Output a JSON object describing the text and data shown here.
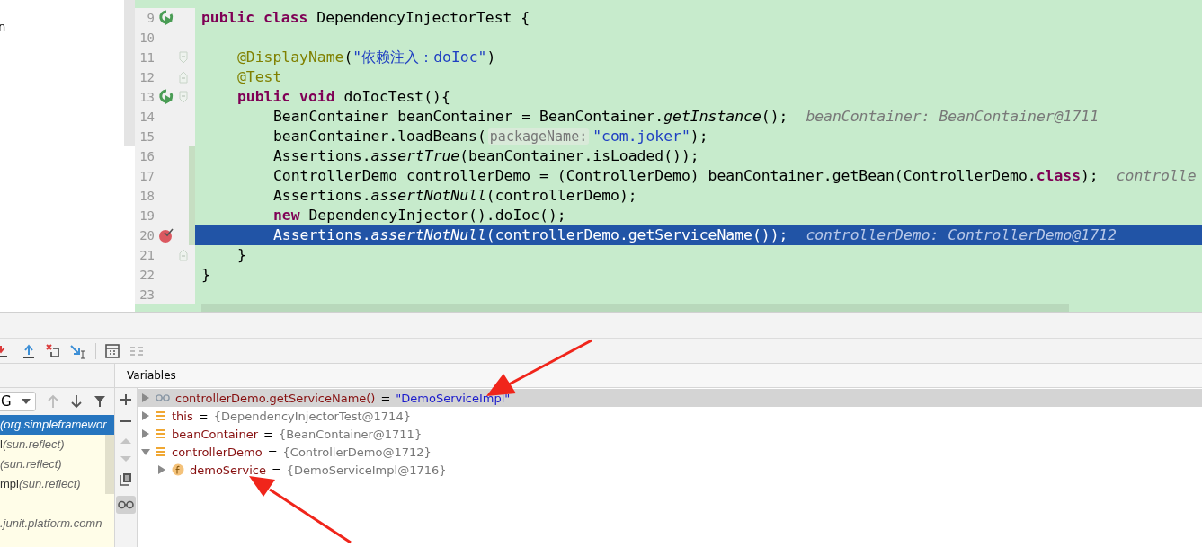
{
  "project_panel": {
    "text": "n"
  },
  "editor": {
    "lines": [
      {
        "number": "9",
        "run_marker": true,
        "breakpoint": false,
        "fold_start": false,
        "fold_end": false,
        "changed": false,
        "selected": false,
        "tokens": [
          {
            "t": "public class",
            "kind": "kw"
          },
          {
            "t": " DependencyInjectorTest {",
            "kind": "txt"
          }
        ],
        "children": [
          {
            "number": "10",
            "run_marker": false,
            "breakpoint": false,
            "fold_start": false,
            "fold_end": false,
            "changed": false,
            "selected": false
          },
          {
            "number": "11",
            "run_marker": false,
            "breakpoint": false,
            "fold_start": true,
            "fold_end": false,
            "changed": false,
            "selected": false,
            "tokens": [
              {
                "t": "@DisplayName",
                "kind": "ann"
              },
              {
                "t": "(",
                "kind": "txt"
              },
              {
                "t": "\"依赖注入：doIoc\"",
                "kind": "str"
              },
              {
                "t": ")",
                "kind": "txt"
              }
            ]
          },
          {
            "number": "12",
            "run_marker": false,
            "breakpoint": false,
            "fold_start": false,
            "fold_end": true,
            "changed": false,
            "selected": false,
            "tokens": [
              {
                "t": "@Test",
                "kind": "ann"
              }
            ]
          },
          {
            "number": "13",
            "run_marker": true,
            "breakpoint": false,
            "fold_start": true,
            "fold_end": false,
            "changed": false,
            "selected": false,
            "tokens": [
              {
                "t": "public void",
                "kind": "kw"
              },
              {
                "t": " doIocTest(){",
                "kind": "txt"
              }
            ],
            "children": [
              {
                "number": "14",
                "run_marker": false,
                "breakpoint": false,
                "fold_start": false,
                "fold_end": false,
                "changed": false,
                "selected": false,
                "tokens": [
                  {
                    "t": "BeanContainer beanContainer = BeanContainer.",
                    "kind": "txt"
                  },
                  {
                    "t": "getInstance",
                    "kind": "it"
                  },
                  {
                    "t": "();",
                    "kind": "txt"
                  },
                  {
                    "t": "beanContainer: BeanContainer@1711",
                    "kind": "val"
                  }
                ]
              },
              {
                "number": "15",
                "run_marker": false,
                "breakpoint": false,
                "fold_start": false,
                "fold_end": false,
                "changed": false,
                "selected": false,
                "tokens": [
                  {
                    "t": "beanContainer.loadBeans(",
                    "kind": "txt"
                  },
                  {
                    "t": "packageName:",
                    "kind": "hint"
                  },
                  {
                    "t": "\"com.joker\"",
                    "kind": "str"
                  },
                  {
                    "t": ");",
                    "kind": "txt"
                  }
                ]
              },
              {
                "number": "16",
                "run_marker": false,
                "breakpoint": false,
                "fold_start": false,
                "fold_end": false,
                "changed": true,
                "selected": false,
                "tokens": [
                  {
                    "t": "Assertions.",
                    "kind": "txt"
                  },
                  {
                    "t": "assertTrue",
                    "kind": "it"
                  },
                  {
                    "t": "(beanContainer.isLoaded());",
                    "kind": "txt"
                  }
                ]
              },
              {
                "number": "17",
                "run_marker": false,
                "breakpoint": false,
                "fold_start": false,
                "fold_end": false,
                "changed": true,
                "selected": false,
                "tokens": [
                  {
                    "t": "ControllerDemo controllerDemo = (ControllerDemo) beanContainer.getBean(ControllerDemo.",
                    "kind": "txt"
                  },
                  {
                    "t": "class",
                    "kind": "kw"
                  },
                  {
                    "t": ");",
                    "kind": "txt"
                  },
                  {
                    "t": "controlle",
                    "kind": "val"
                  }
                ]
              },
              {
                "number": "18",
                "run_marker": false,
                "breakpoint": false,
                "fold_start": false,
                "fold_end": false,
                "changed": true,
                "selected": false,
                "tokens": [
                  {
                    "t": "Assertions.",
                    "kind": "txt"
                  },
                  {
                    "t": "assertNotNull",
                    "kind": "it"
                  },
                  {
                    "t": "(controllerDemo);",
                    "kind": "txt"
                  }
                ]
              },
              {
                "number": "19",
                "run_marker": false,
                "breakpoint": false,
                "fold_start": false,
                "fold_end": false,
                "changed": true,
                "selected": false,
                "tokens": [
                  {
                    "t": "new",
                    "kind": "kw"
                  },
                  {
                    "t": " DependencyInjector().doIoc();",
                    "kind": "txt"
                  }
                ]
              },
              {
                "number": "20",
                "run_marker": false,
                "breakpoint": true,
                "fold_start": false,
                "fold_end": false,
                "changed": true,
                "selected": true,
                "tokens": [
                  {
                    "t": "Assertions.",
                    "kind": "txt"
                  },
                  {
                    "t": "assertNotNull",
                    "kind": "it"
                  },
                  {
                    "t": "(controllerDemo.getServiceName());",
                    "kind": "txt"
                  },
                  {
                    "t": "controllerDemo: ControllerDemo@1712",
                    "kind": "val"
                  }
                ]
              }
            ]
          },
          {
            "number": "21",
            "run_marker": false,
            "breakpoint": false,
            "fold_start": false,
            "fold_end": true,
            "changed": false,
            "selected": false,
            "tokens": [
              {
                "t": "}",
                "kind": "txt"
              }
            ]
          }
        ]
      },
      {
        "number": "22",
        "run_marker": false,
        "breakpoint": false,
        "fold_start": false,
        "fold_end": false,
        "changed": false,
        "selected": false,
        "tokens": [
          {
            "t": "}",
            "kind": "txt"
          }
        ]
      },
      {
        "number": "23",
        "run_marker": false,
        "breakpoint": false,
        "fold_start": false,
        "fold_end": false,
        "changed": false,
        "selected": false
      }
    ]
  },
  "frames": {
    "thread": "G",
    "items": [
      {
        "pkg": "(org.simpleframewor",
        "selected": true
      },
      {
        "name": "l",
        "pkg": "(sun.reflect)",
        "selected": false
      },
      {
        "pkg": "(sun.reflect)",
        "selected": false
      },
      {
        "name": "mpl",
        "pkg": "(sun.reflect)",
        "selected": false
      },
      {
        "selected": false
      },
      {
        "pkg": ".junit.platform.comn",
        "selected": false
      }
    ]
  },
  "variables": {
    "title": "Variables",
    "items": [
      {
        "kind": "watch",
        "name": "controllerDemo.getServiceName()",
        "op": "=",
        "value": "\"DemoServiceImpl\"",
        "is_string": true,
        "expanded": false,
        "selected": true
      },
      {
        "kind": "var",
        "name": "this",
        "op": "=",
        "value": "{DependencyInjectorTest@1714}",
        "is_string": false,
        "expanded": false,
        "selected": false
      },
      {
        "kind": "var",
        "name": "beanContainer",
        "op": "=",
        "value": "{BeanContainer@1711}",
        "is_string": false,
        "expanded": false,
        "selected": false
      },
      {
        "kind": "var",
        "name": "controllerDemo",
        "op": "=",
        "value": "{ControllerDemo@1712}",
        "is_string": false,
        "expanded": true,
        "selected": false,
        "children": [
          {
            "kind": "field",
            "name": "demoService",
            "op": "=",
            "value": "{DemoServiceImpl@1716}",
            "is_string": false,
            "expanded": false,
            "selected": false
          }
        ]
      }
    ]
  },
  "watches_toggle": {
    "on": true
  }
}
